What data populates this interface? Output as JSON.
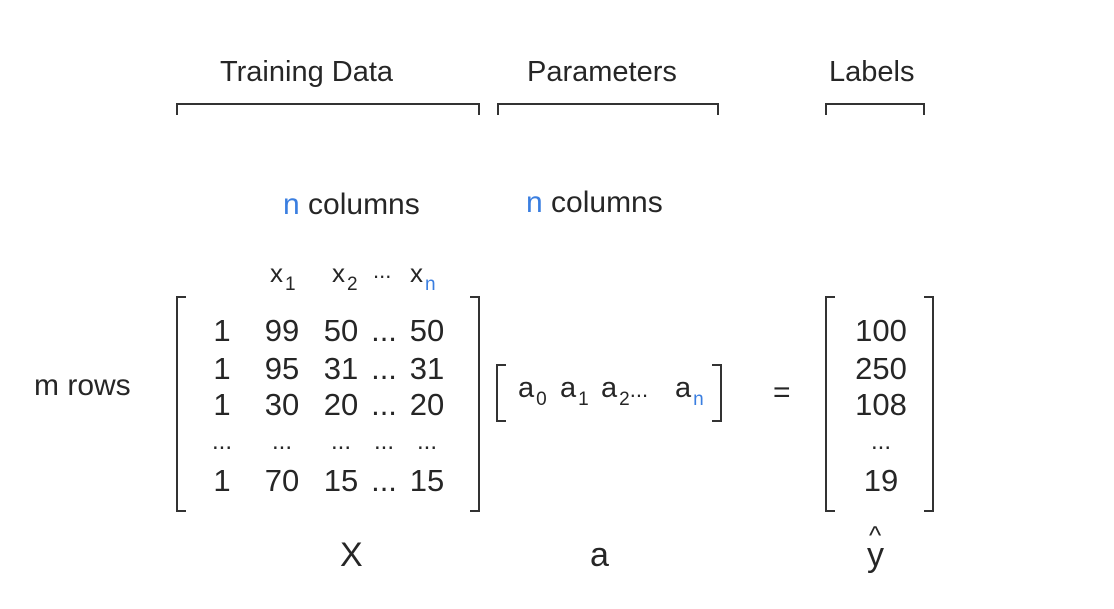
{
  "headers": {
    "training": "Training Data",
    "parameters": "Parameters",
    "labels": "Labels"
  },
  "columns_caption": {
    "n": "n",
    "text": "columns"
  },
  "rows_caption": "m rows",
  "feature_headers": [
    {
      "base": "x",
      "sub": "1"
    },
    {
      "base": "x",
      "sub": "2"
    },
    {
      "ellipsis": "..."
    },
    {
      "base": "x",
      "sub": "n"
    }
  ],
  "matrix_X": [
    [
      "1",
      "99",
      "50",
      "...",
      "50"
    ],
    [
      "1",
      "95",
      "31",
      "...",
      "31"
    ],
    [
      "1",
      "30",
      "20",
      "...",
      "20"
    ],
    [
      "...",
      "...",
      "...",
      "...",
      "..."
    ],
    [
      "1",
      "70",
      "15",
      "...",
      "15"
    ]
  ],
  "params": [
    {
      "base": "a",
      "sub": "0"
    },
    {
      "base": "a",
      "sub": "1"
    },
    {
      "base": "a",
      "sub": "2",
      "trail": "..."
    },
    {
      "base": "a",
      "sub": "n"
    }
  ],
  "equals": "=",
  "labels_vector": [
    "100",
    "250",
    "108",
    "...",
    "19"
  ],
  "names": {
    "X": "X",
    "a": "a",
    "y": "y",
    "hat": "^"
  },
  "colors": {
    "accent": "#3a7ee0",
    "text": "#262626"
  }
}
